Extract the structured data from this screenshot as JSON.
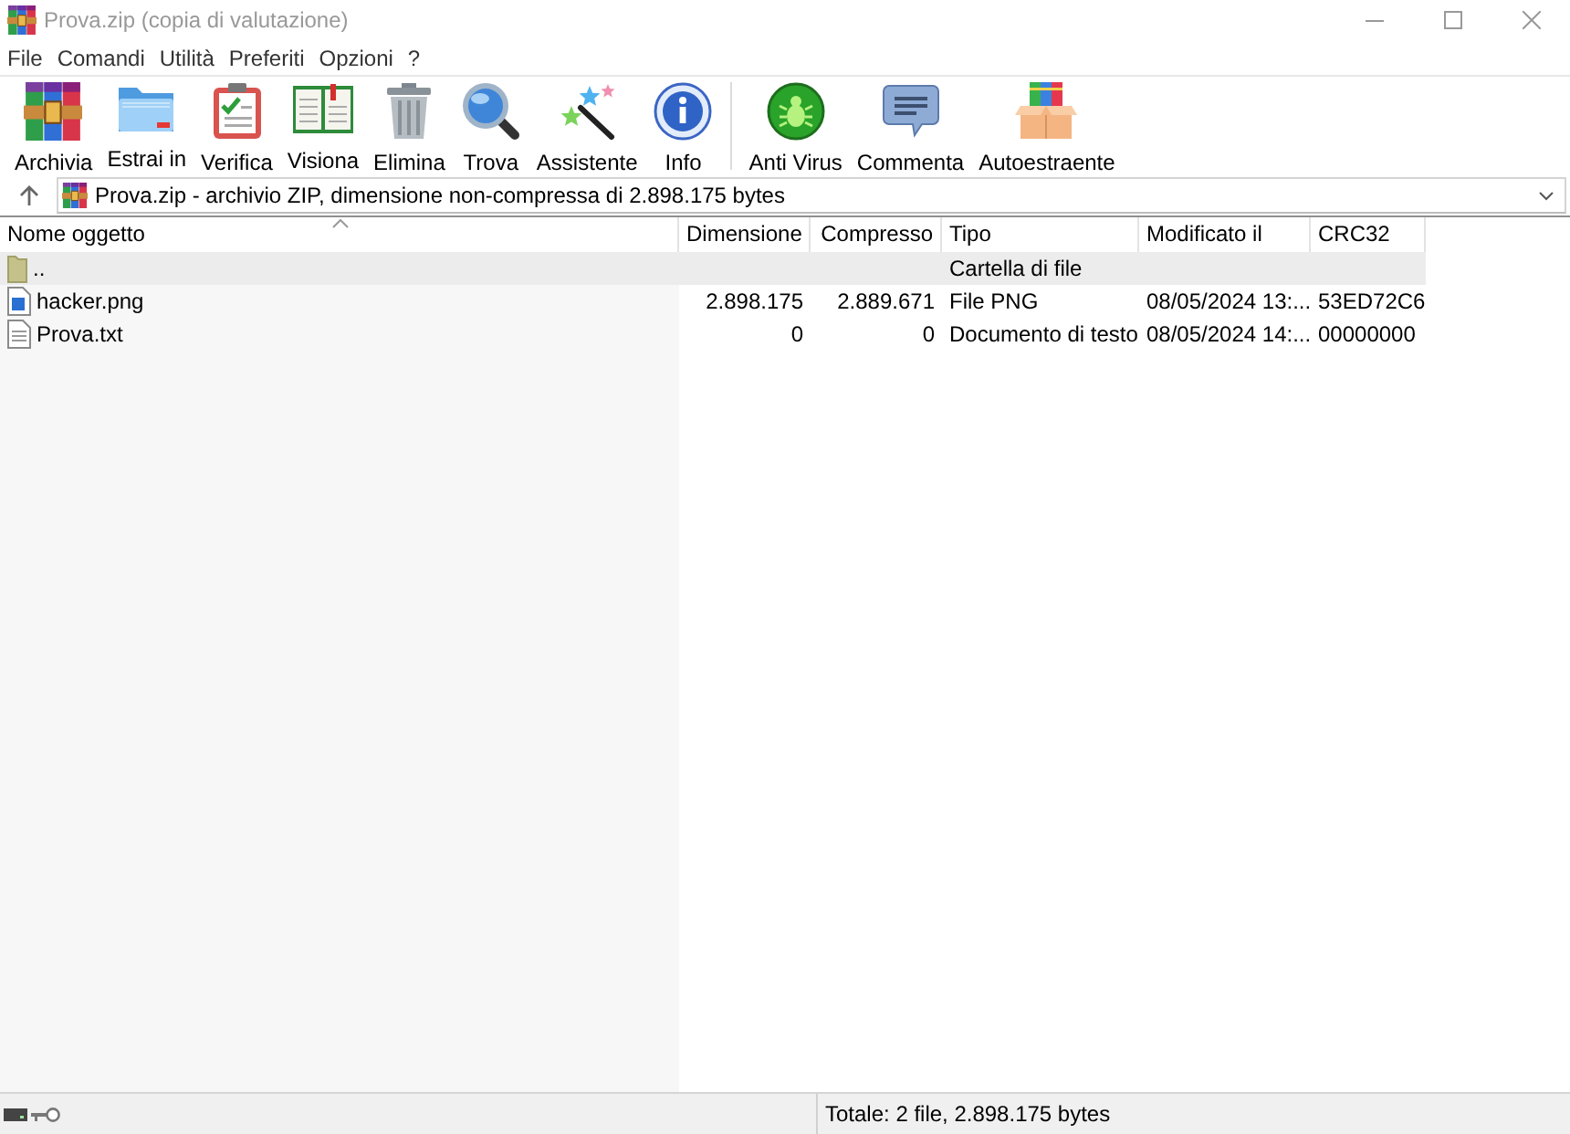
{
  "window": {
    "title": "Prova.zip (copia di valutazione)"
  },
  "menu": [
    {
      "label": "File"
    },
    {
      "label": "Comandi"
    },
    {
      "label": "Utilità"
    },
    {
      "label": "Preferiti"
    },
    {
      "label": "Opzioni"
    },
    {
      "label": "?"
    }
  ],
  "toolbar": {
    "groups": [
      {
        "buttons": [
          {
            "label": "Archivia"
          },
          {
            "label": "Estrai in"
          },
          {
            "label": "Verifica"
          },
          {
            "label": "Visiona"
          },
          {
            "label": "Elimina"
          },
          {
            "label": "Trova"
          },
          {
            "label": "Assistente"
          },
          {
            "label": "Info"
          }
        ]
      },
      {
        "buttons": [
          {
            "label": "Anti Virus"
          },
          {
            "label": "Commenta"
          },
          {
            "label": "Autoestraente"
          }
        ]
      }
    ]
  },
  "address_bar": {
    "text": "Prova.zip - archivio ZIP, dimensione non-compressa di 2.898.175 bytes"
  },
  "file_list": {
    "columns": [
      {
        "label": "Nome oggetto",
        "sorted": true
      },
      {
        "label": "Dimensione",
        "sorted": false
      },
      {
        "label": "Compresso",
        "sorted": false
      },
      {
        "label": "Tipo",
        "sorted": false
      },
      {
        "label": "Modificato il",
        "sorted": false
      },
      {
        "label": "CRC32",
        "sorted": false
      }
    ],
    "rows": [
      {
        "kind": "parent_folder",
        "selected": true,
        "name": "..",
        "type": "Cartella di file"
      },
      {
        "kind": "image",
        "selected": false,
        "name": "hacker.png",
        "size": "2.898.175",
        "packed": "2.889.671",
        "type": "File PNG",
        "modified": "08/05/2024 13:...",
        "crc32": "53ED72C6"
      },
      {
        "kind": "text",
        "selected": false,
        "name": "Prova.txt",
        "size": "0",
        "packed": "0",
        "type": "Documento di testo",
        "modified": "08/05/2024 14:...",
        "crc32": "00000000"
      }
    ]
  },
  "status_bar": {
    "text": "Totale: 2 file, 2.898.175 bytes"
  }
}
